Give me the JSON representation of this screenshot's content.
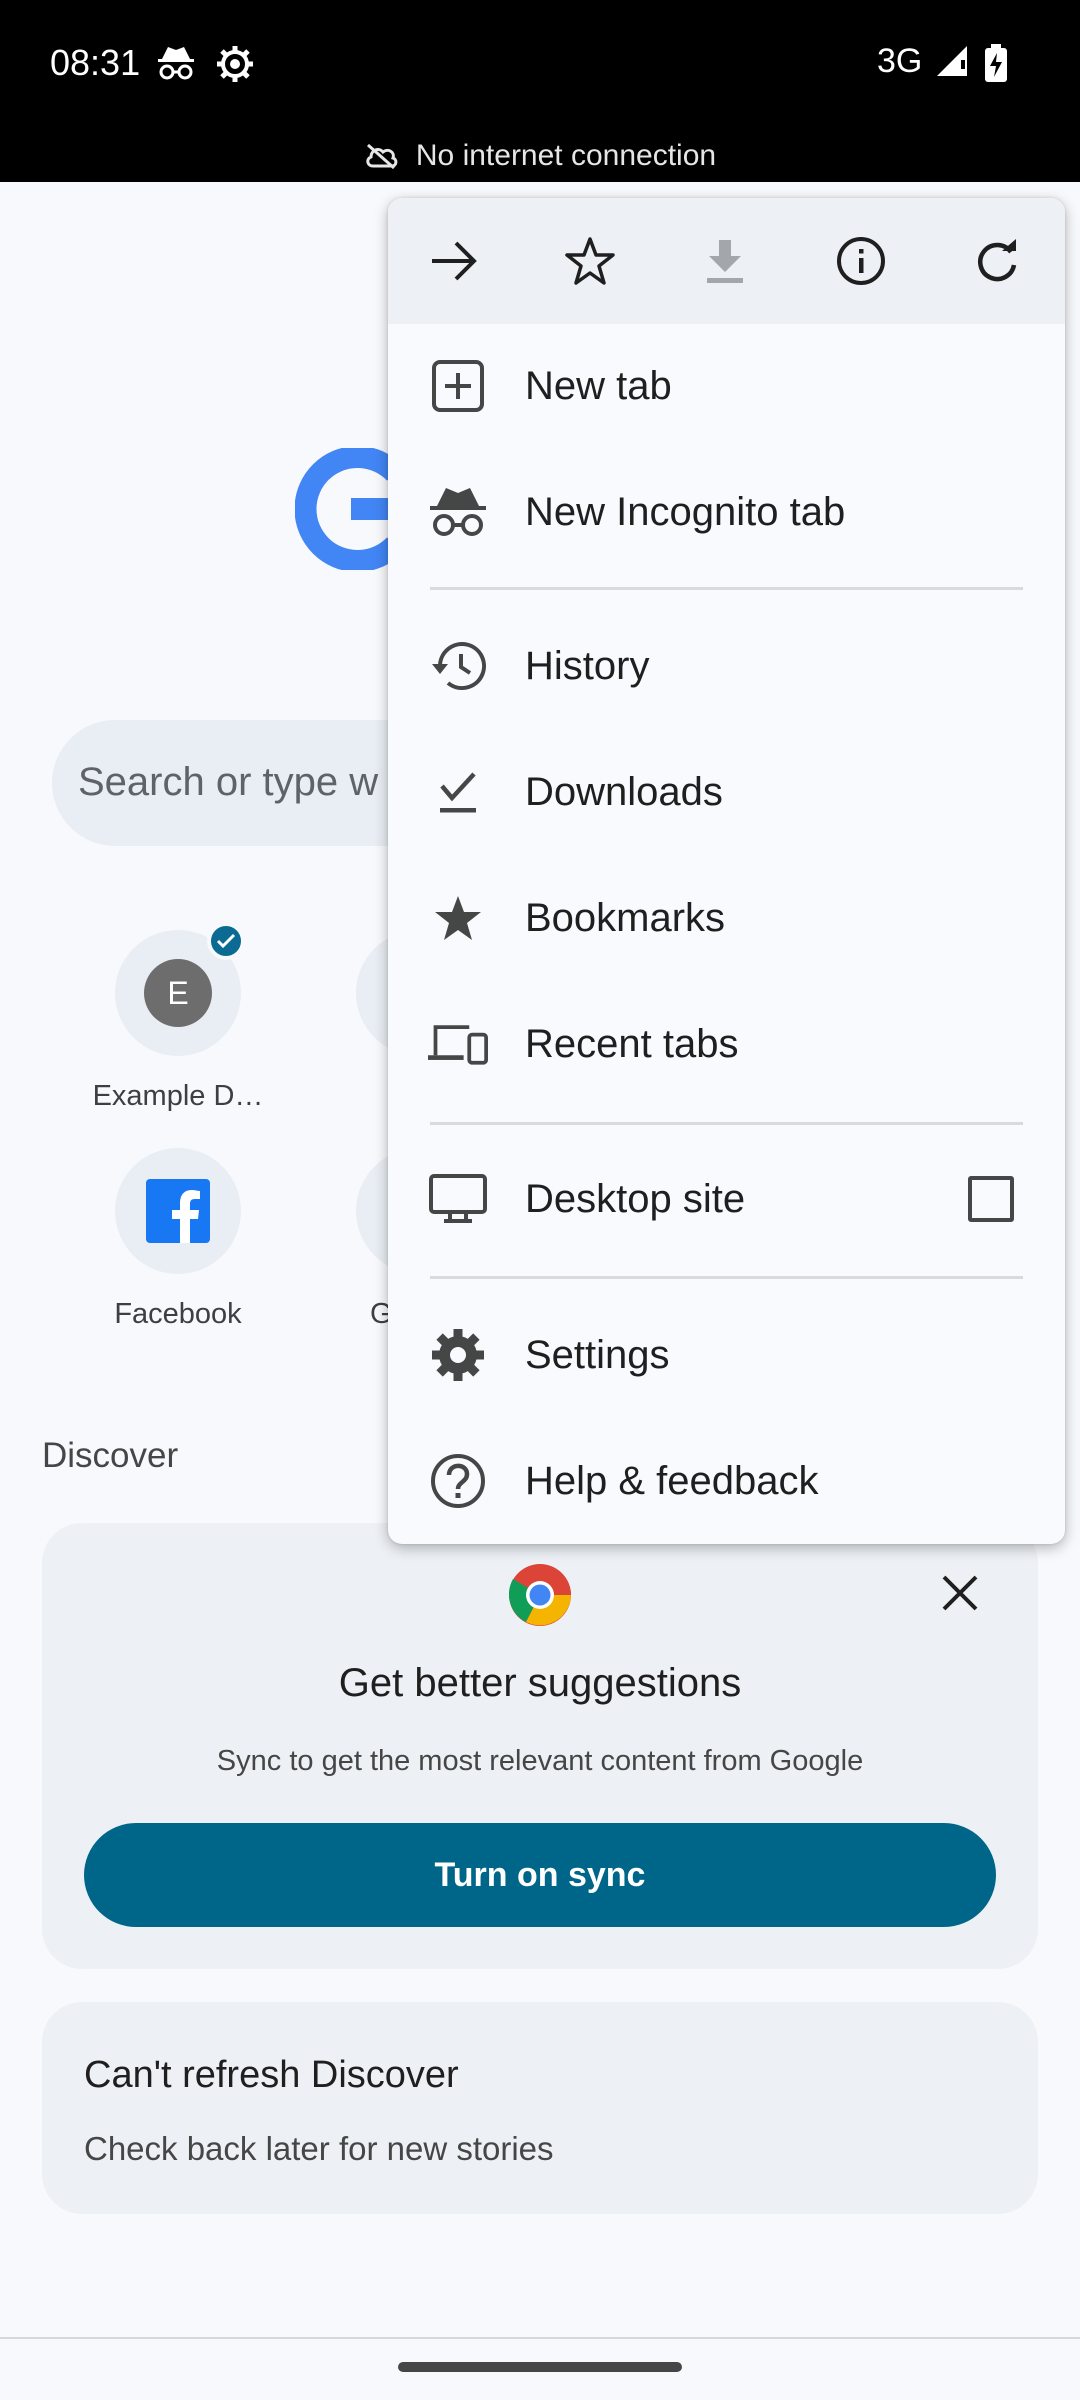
{
  "status_bar": {
    "time": "08:31",
    "left_icons": [
      "incognito-icon",
      "settings-gear-icon"
    ],
    "network": "3G",
    "right_icons": [
      "signal-icon",
      "battery-charging-icon"
    ],
    "offline_message": "No internet connection"
  },
  "page": {
    "search_placeholder": "Search or type w",
    "shortcuts": [
      {
        "label": "Example D…",
        "avatar_letter": "E"
      },
      {
        "label": "Facebook"
      }
    ],
    "partial_tile_letter": "G",
    "discover_label": "Discover",
    "sync_card": {
      "title": "Get better suggestions",
      "subtitle": "Sync to get the most relevant content from Google",
      "button": "Turn on sync"
    },
    "refresh_card": {
      "title": "Can't refresh Discover",
      "subtitle": "Check back later for new stories"
    }
  },
  "menu": {
    "toolbar_icons": [
      "forward-arrow-icon",
      "bookmark-star-icon",
      "download-icon",
      "page-info-icon",
      "refresh-icon"
    ],
    "items": [
      {
        "label": "New tab",
        "icon": "new-tab-icon"
      },
      {
        "label": "New Incognito tab",
        "icon": "incognito-icon"
      },
      {
        "label": "History",
        "icon": "history-icon"
      },
      {
        "label": "Downloads",
        "icon": "downloads-icon"
      },
      {
        "label": "Bookmarks",
        "icon": "bookmarks-star-icon"
      },
      {
        "label": "Recent tabs",
        "icon": "devices-icon"
      },
      {
        "label": "Desktop site",
        "icon": "monitor-icon",
        "checked": false
      },
      {
        "label": "Settings",
        "icon": "gear-icon"
      },
      {
        "label": "Help & feedback",
        "icon": "help-icon"
      }
    ]
  },
  "colors": {
    "accent": "#006689",
    "background": "#f8f9fc",
    "card": "#edf1f6",
    "google_blue": "#4285f4"
  }
}
